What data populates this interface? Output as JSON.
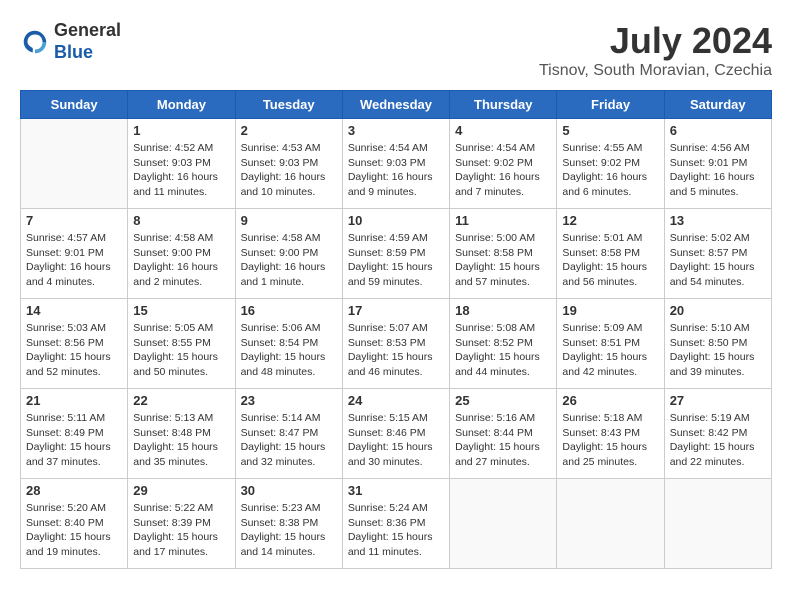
{
  "header": {
    "logo_line1": "General",
    "logo_line2": "Blue",
    "month_title": "July 2024",
    "location": "Tisnov, South Moravian, Czechia"
  },
  "weekdays": [
    "Sunday",
    "Monday",
    "Tuesday",
    "Wednesday",
    "Thursday",
    "Friday",
    "Saturday"
  ],
  "weeks": [
    [
      {
        "day": "",
        "info": ""
      },
      {
        "day": "1",
        "info": "Sunrise: 4:52 AM\nSunset: 9:03 PM\nDaylight: 16 hours\nand 11 minutes."
      },
      {
        "day": "2",
        "info": "Sunrise: 4:53 AM\nSunset: 9:03 PM\nDaylight: 16 hours\nand 10 minutes."
      },
      {
        "day": "3",
        "info": "Sunrise: 4:54 AM\nSunset: 9:03 PM\nDaylight: 16 hours\nand 9 minutes."
      },
      {
        "day": "4",
        "info": "Sunrise: 4:54 AM\nSunset: 9:02 PM\nDaylight: 16 hours\nand 7 minutes."
      },
      {
        "day": "5",
        "info": "Sunrise: 4:55 AM\nSunset: 9:02 PM\nDaylight: 16 hours\nand 6 minutes."
      },
      {
        "day": "6",
        "info": "Sunrise: 4:56 AM\nSunset: 9:01 PM\nDaylight: 16 hours\nand 5 minutes."
      }
    ],
    [
      {
        "day": "7",
        "info": "Sunrise: 4:57 AM\nSunset: 9:01 PM\nDaylight: 16 hours\nand 4 minutes."
      },
      {
        "day": "8",
        "info": "Sunrise: 4:58 AM\nSunset: 9:00 PM\nDaylight: 16 hours\nand 2 minutes."
      },
      {
        "day": "9",
        "info": "Sunrise: 4:58 AM\nSunset: 9:00 PM\nDaylight: 16 hours\nand 1 minute."
      },
      {
        "day": "10",
        "info": "Sunrise: 4:59 AM\nSunset: 8:59 PM\nDaylight: 15 hours\nand 59 minutes."
      },
      {
        "day": "11",
        "info": "Sunrise: 5:00 AM\nSunset: 8:58 PM\nDaylight: 15 hours\nand 57 minutes."
      },
      {
        "day": "12",
        "info": "Sunrise: 5:01 AM\nSunset: 8:58 PM\nDaylight: 15 hours\nand 56 minutes."
      },
      {
        "day": "13",
        "info": "Sunrise: 5:02 AM\nSunset: 8:57 PM\nDaylight: 15 hours\nand 54 minutes."
      }
    ],
    [
      {
        "day": "14",
        "info": "Sunrise: 5:03 AM\nSunset: 8:56 PM\nDaylight: 15 hours\nand 52 minutes."
      },
      {
        "day": "15",
        "info": "Sunrise: 5:05 AM\nSunset: 8:55 PM\nDaylight: 15 hours\nand 50 minutes."
      },
      {
        "day": "16",
        "info": "Sunrise: 5:06 AM\nSunset: 8:54 PM\nDaylight: 15 hours\nand 48 minutes."
      },
      {
        "day": "17",
        "info": "Sunrise: 5:07 AM\nSunset: 8:53 PM\nDaylight: 15 hours\nand 46 minutes."
      },
      {
        "day": "18",
        "info": "Sunrise: 5:08 AM\nSunset: 8:52 PM\nDaylight: 15 hours\nand 44 minutes."
      },
      {
        "day": "19",
        "info": "Sunrise: 5:09 AM\nSunset: 8:51 PM\nDaylight: 15 hours\nand 42 minutes."
      },
      {
        "day": "20",
        "info": "Sunrise: 5:10 AM\nSunset: 8:50 PM\nDaylight: 15 hours\nand 39 minutes."
      }
    ],
    [
      {
        "day": "21",
        "info": "Sunrise: 5:11 AM\nSunset: 8:49 PM\nDaylight: 15 hours\nand 37 minutes."
      },
      {
        "day": "22",
        "info": "Sunrise: 5:13 AM\nSunset: 8:48 PM\nDaylight: 15 hours\nand 35 minutes."
      },
      {
        "day": "23",
        "info": "Sunrise: 5:14 AM\nSunset: 8:47 PM\nDaylight: 15 hours\nand 32 minutes."
      },
      {
        "day": "24",
        "info": "Sunrise: 5:15 AM\nSunset: 8:46 PM\nDaylight: 15 hours\nand 30 minutes."
      },
      {
        "day": "25",
        "info": "Sunrise: 5:16 AM\nSunset: 8:44 PM\nDaylight: 15 hours\nand 27 minutes."
      },
      {
        "day": "26",
        "info": "Sunrise: 5:18 AM\nSunset: 8:43 PM\nDaylight: 15 hours\nand 25 minutes."
      },
      {
        "day": "27",
        "info": "Sunrise: 5:19 AM\nSunset: 8:42 PM\nDaylight: 15 hours\nand 22 minutes."
      }
    ],
    [
      {
        "day": "28",
        "info": "Sunrise: 5:20 AM\nSunset: 8:40 PM\nDaylight: 15 hours\nand 19 minutes."
      },
      {
        "day": "29",
        "info": "Sunrise: 5:22 AM\nSunset: 8:39 PM\nDaylight: 15 hours\nand 17 minutes."
      },
      {
        "day": "30",
        "info": "Sunrise: 5:23 AM\nSunset: 8:38 PM\nDaylight: 15 hours\nand 14 minutes."
      },
      {
        "day": "31",
        "info": "Sunrise: 5:24 AM\nSunset: 8:36 PM\nDaylight: 15 hours\nand 11 minutes."
      },
      {
        "day": "",
        "info": ""
      },
      {
        "day": "",
        "info": ""
      },
      {
        "day": "",
        "info": ""
      }
    ]
  ]
}
